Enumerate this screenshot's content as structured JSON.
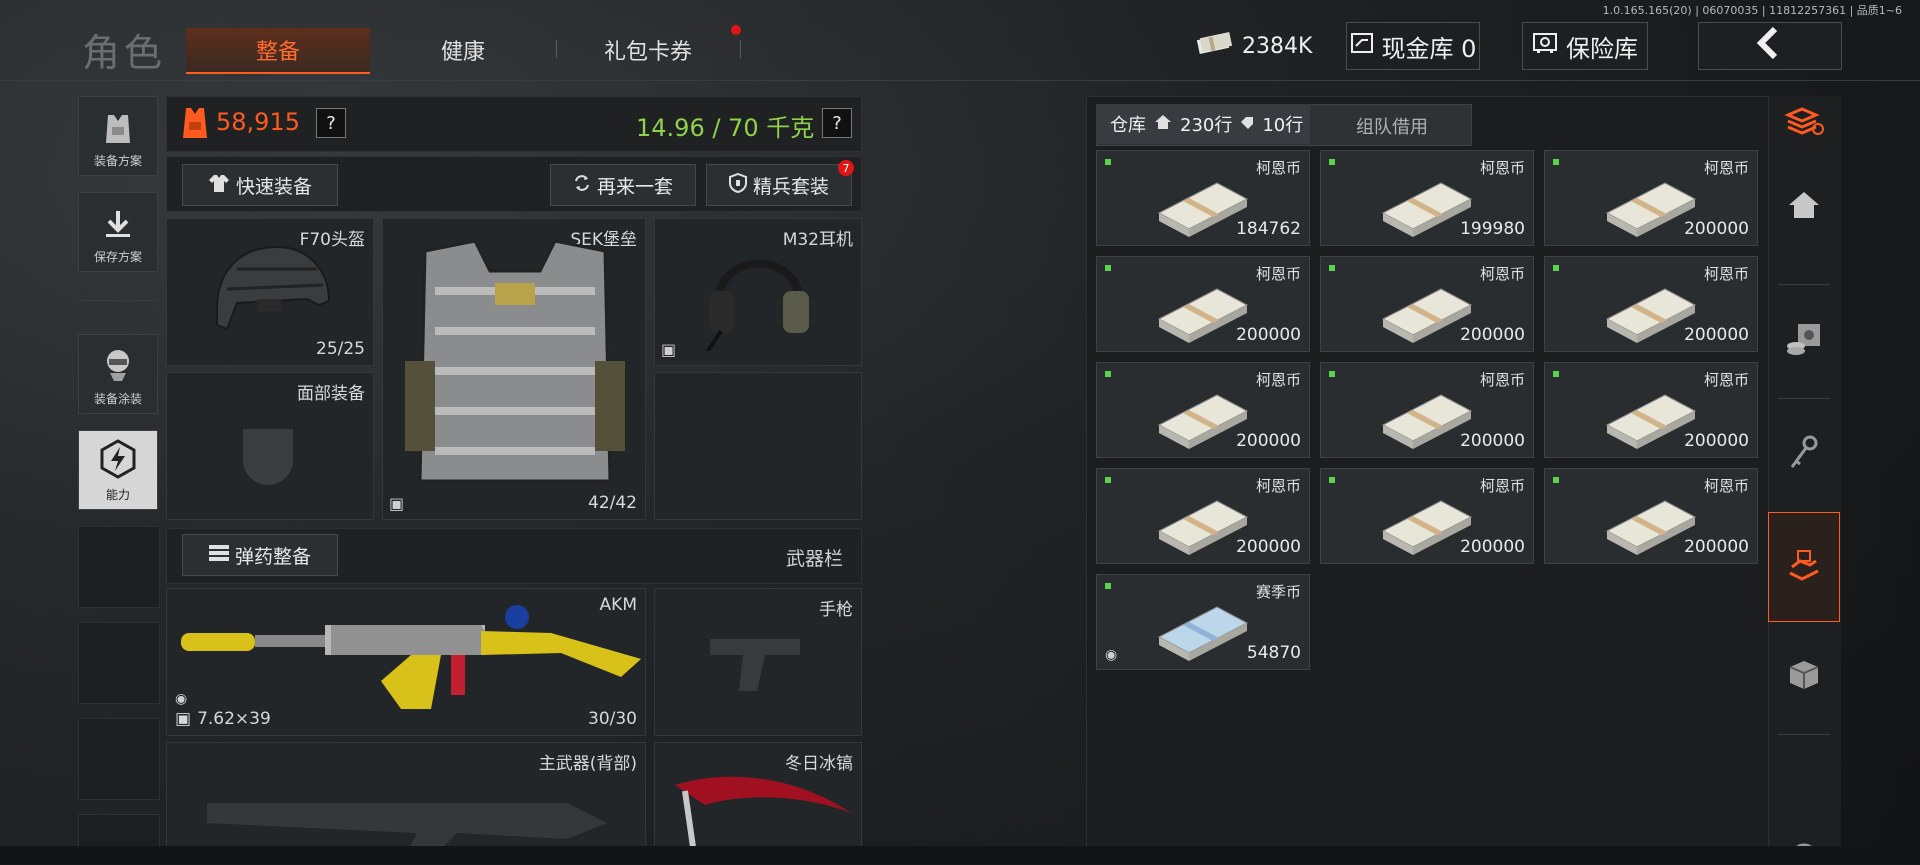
{
  "version": "1.0.165.165(20) | 06070035 | 11812257361 | 品质1~6",
  "title": "角色",
  "tabs": [
    {
      "label": "整备",
      "active": true
    },
    {
      "label": "健康",
      "active": false
    },
    {
      "label": "礼包卡券",
      "active": false
    }
  ],
  "top": {
    "money": "2384K",
    "cash_vault": "现金库 0",
    "safe": "保险库"
  },
  "side": [
    {
      "label": "装备方案"
    },
    {
      "label": "保存方案"
    },
    {
      "label": "装备涂装"
    },
    {
      "label": "能力"
    }
  ],
  "gear": {
    "value": "58,915",
    "weight": "14.96 / 70 千克",
    "help": "?",
    "quick_equip": "快速装备",
    "again": "再来一套",
    "elite": "精兵套装",
    "elite_badge": "7",
    "helmet": {
      "name": "F70头盔",
      "dur": "25/25"
    },
    "armor": {
      "name": "SEK堡垒",
      "dur": "42/42"
    },
    "headset": {
      "name": "M32耳机"
    },
    "face": {
      "name": "面部装备"
    },
    "ammo_btn": "弹药整备",
    "weapon_bar": "武器栏",
    "primary": {
      "name": "AKM",
      "caliber": "7.62×39",
      "ammo": "30/30"
    },
    "pistol": {
      "name": "手枪"
    },
    "back": {
      "name": "主武器(背部)"
    },
    "melee": {
      "name": "冬日冰镐"
    }
  },
  "warehouse": {
    "tab_label": "仓库",
    "rows_a": "230行",
    "rows_b": "10行",
    "team_borrow": "组队借用",
    "items": [
      {
        "name": "柯恩币",
        "qty": "184762"
      },
      {
        "name": "柯恩币",
        "qty": "199980"
      },
      {
        "name": "柯恩币",
        "qty": "200000"
      },
      {
        "name": "柯恩币",
        "qty": "200000"
      },
      {
        "name": "柯恩币",
        "qty": "200000"
      },
      {
        "name": "柯恩币",
        "qty": "200000"
      },
      {
        "name": "柯恩币",
        "qty": "200000"
      },
      {
        "name": "柯恩币",
        "qty": "200000"
      },
      {
        "name": "柯恩币",
        "qty": "200000"
      },
      {
        "name": "柯恩币",
        "qty": "200000"
      },
      {
        "name": "柯恩币",
        "qty": "200000"
      },
      {
        "name": "柯恩币",
        "qty": "200000"
      },
      {
        "name": "赛季币",
        "qty": "54870"
      }
    ]
  },
  "colors": {
    "accent": "#ff5a1f",
    "green": "#8fd14a",
    "badge": "#e01515"
  }
}
